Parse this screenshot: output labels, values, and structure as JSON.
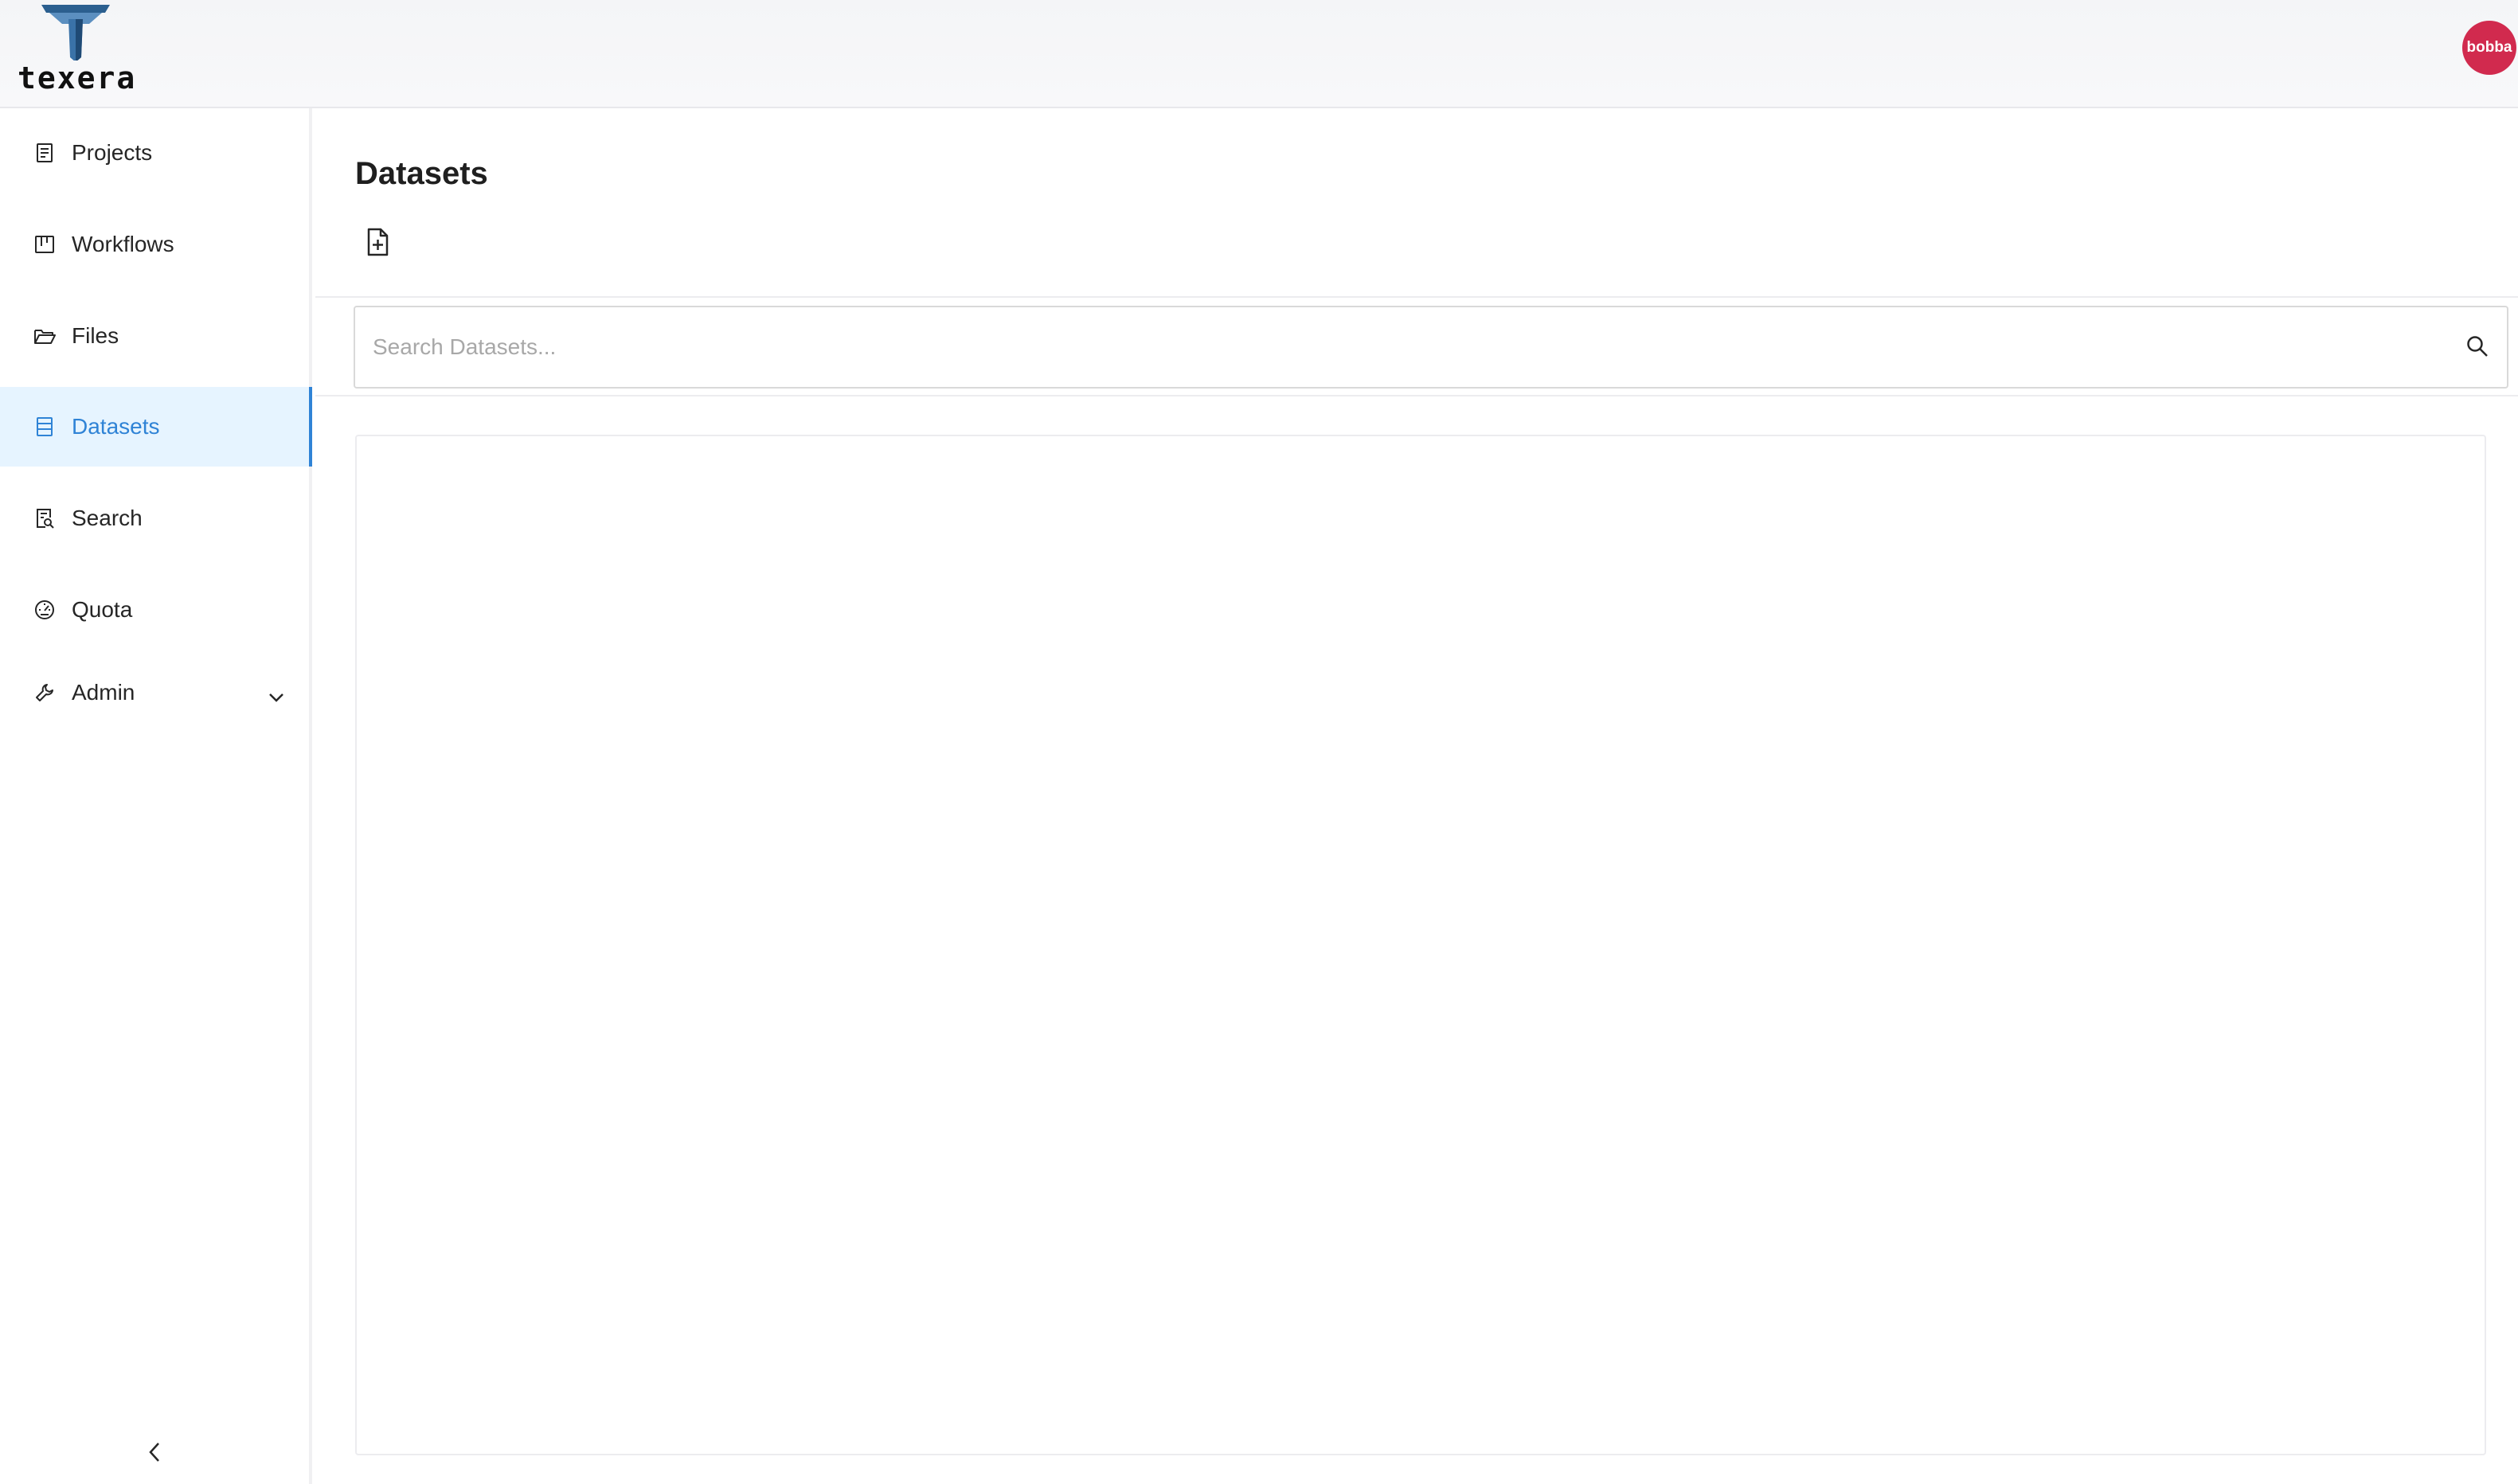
{
  "header": {
    "logo_text": "texera",
    "user_avatar": "bobba"
  },
  "sidebar": {
    "items": [
      {
        "label": "Projects",
        "icon": "project-icon"
      },
      {
        "label": "Workflows",
        "icon": "workflow-icon"
      },
      {
        "label": "Files",
        "icon": "folder-icon"
      },
      {
        "label": "Datasets",
        "icon": "database-icon",
        "active": true
      },
      {
        "label": "Search",
        "icon": "file-search-icon"
      },
      {
        "label": "Quota",
        "icon": "dashboard-icon"
      },
      {
        "label": "Admin",
        "icon": "tool-icon",
        "expandable": true
      }
    ],
    "collapse_icon": "chevron-left-icon"
  },
  "main": {
    "title": "Datasets",
    "add_button_icon": "file-add-icon",
    "search": {
      "placeholder": "Search Datasets...",
      "value": ""
    }
  },
  "colors": {
    "accent": "#2f83d6",
    "active_bg": "#e6f4ff",
    "avatar_bg": "#d12a4e"
  }
}
